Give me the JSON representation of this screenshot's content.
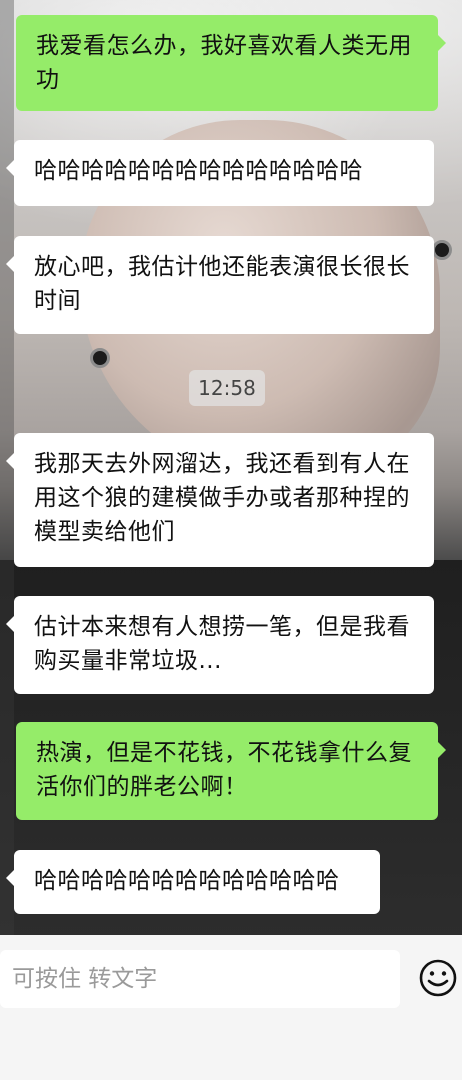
{
  "messages": [
    {
      "side": "right",
      "text": "我爱看怎么办，我好喜欢看人类无用功"
    },
    {
      "side": "left",
      "text": "哈哈哈哈哈哈哈哈哈哈哈哈哈哈"
    },
    {
      "side": "left",
      "text": "放心吧，我估计他还能表演很长很长时间"
    },
    {
      "side": "left",
      "text": "我那天去外网溜达，我还看到有人在用这个狼的建模做手办或者那种捏的模型卖给他们"
    },
    {
      "side": "left",
      "text": "估计本来想有人想捞一笔，但是我看购买量非常垃圾..."
    },
    {
      "side": "right",
      "text": "热演，但是不花钱，不花钱拿什么复活你们的胖老公啊！"
    },
    {
      "side": "left",
      "text": "哈哈哈哈哈哈哈哈哈哈哈哈哈"
    }
  ],
  "timestamp": "12:58",
  "input": {
    "placeholder": "可按住 转文字"
  },
  "icons": {
    "emoji": "emoji-face-icon"
  },
  "colors": {
    "green_bubble": "#95ec69",
    "white_bubble": "#ffffff",
    "input_bar": "#f5f5f5"
  }
}
